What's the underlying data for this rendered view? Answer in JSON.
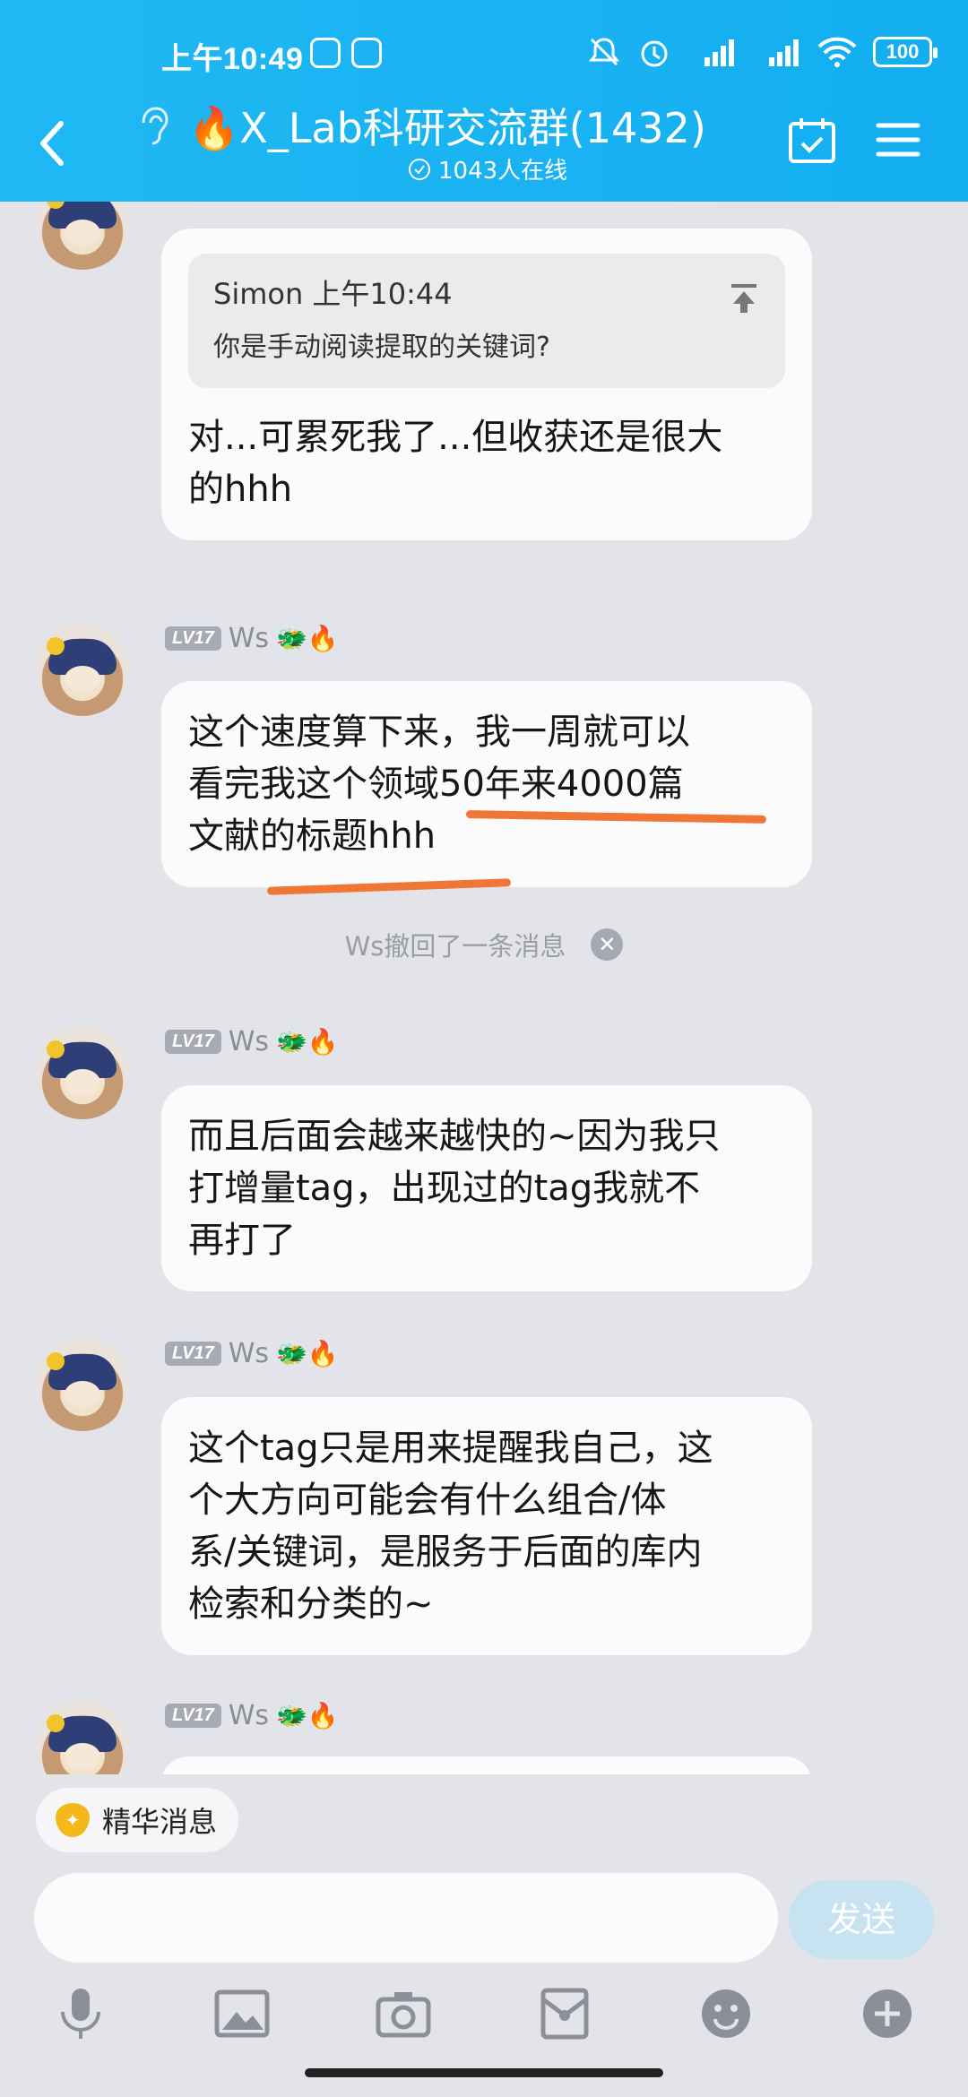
{
  "status_bar": {
    "time": "上午10:49",
    "battery": "100"
  },
  "header": {
    "title": "🔥X_Lab科研交流群(1432)",
    "online_count": "1043人在线"
  },
  "messages": [
    {
      "quote": {
        "author": "Simon 上午10:44",
        "text": "你是手动阅读提取的关键词?"
      },
      "lines": [
        "对...可累死我了...但收获还是很大",
        "的hhh"
      ]
    },
    {
      "level": "LV17",
      "name": "Ws",
      "lines": [
        "这个速度算下来，我一周就可以",
        "看完我这个领域50年来4000篇",
        "文献的标题hhh"
      ]
    },
    {
      "level": "LV17",
      "name": "Ws",
      "lines": [
        "而且后面会越来越快的~因为我只",
        "打增量tag，出现过的tag我就不",
        "再打了"
      ]
    },
    {
      "level": "LV17",
      "name": "Ws",
      "lines": [
        "这个tag只是用来提醒我自己，这",
        "个大方向可能会有什么组合/体",
        "系/关键词，是服务于后面的库内",
        "检索和分类的~"
      ]
    },
    {
      "level": "LV17",
      "name": "Ws"
    }
  ],
  "recall_notice": "Ws撤回了一条消息",
  "essence": {
    "label": "精华消息"
  },
  "composer": {
    "send_label": "发送"
  },
  "icons": {
    "back": "back-arrow-icon",
    "ear": "ear-icon",
    "calendar": "calendar-check-icon",
    "menu": "menu-icon",
    "mic": "microphone-icon",
    "image": "image-icon",
    "camera": "camera-icon",
    "red_packet": "red-packet-icon",
    "emoji": "emoji-icon",
    "plus": "plus-icon"
  },
  "colors": {
    "header": "#19b2f2",
    "highlight_underline": "#f07636",
    "send_button": "#c7e3f1"
  }
}
